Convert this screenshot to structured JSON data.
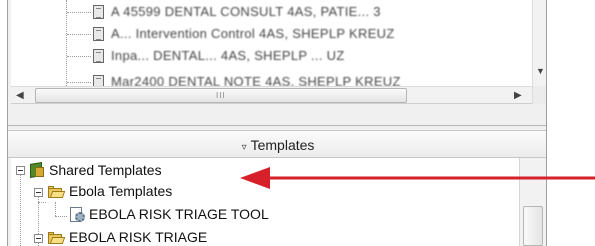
{
  "top_list": {
    "rows": [
      {
        "text": "A 45599 DENTAL CONSULT 4AS, PATIE... 3"
      },
      {
        "text": "A... Intervention Control 4AS, SHEPLP KREUZ"
      },
      {
        "text": "Inpa... DENTAL... 4AS, SHEPLP ... UZ"
      },
      {
        "text": "Mar2400 DENTAL NOTE 4AS, SHEPLP KREUZ"
      }
    ],
    "scrollbar_grip": "III"
  },
  "templates_panel": {
    "header_label": "Templates",
    "collapse_glyph": "▿"
  },
  "tree": {
    "shared": {
      "label": "Shared Templates",
      "icon": "shared-templates-icon"
    },
    "ebola_folder": {
      "label": "Ebola Templates",
      "icon": "open-folder-icon"
    },
    "risk_tool": {
      "label": "EBOLA RISK TRIAGE TOOL",
      "icon": "template-tool-icon"
    },
    "partial_folder": {
      "label": "EBOLA RISK TRIAGE",
      "icon": "open-folder-icon"
    }
  },
  "annotation": {
    "color": "#d6202a"
  }
}
